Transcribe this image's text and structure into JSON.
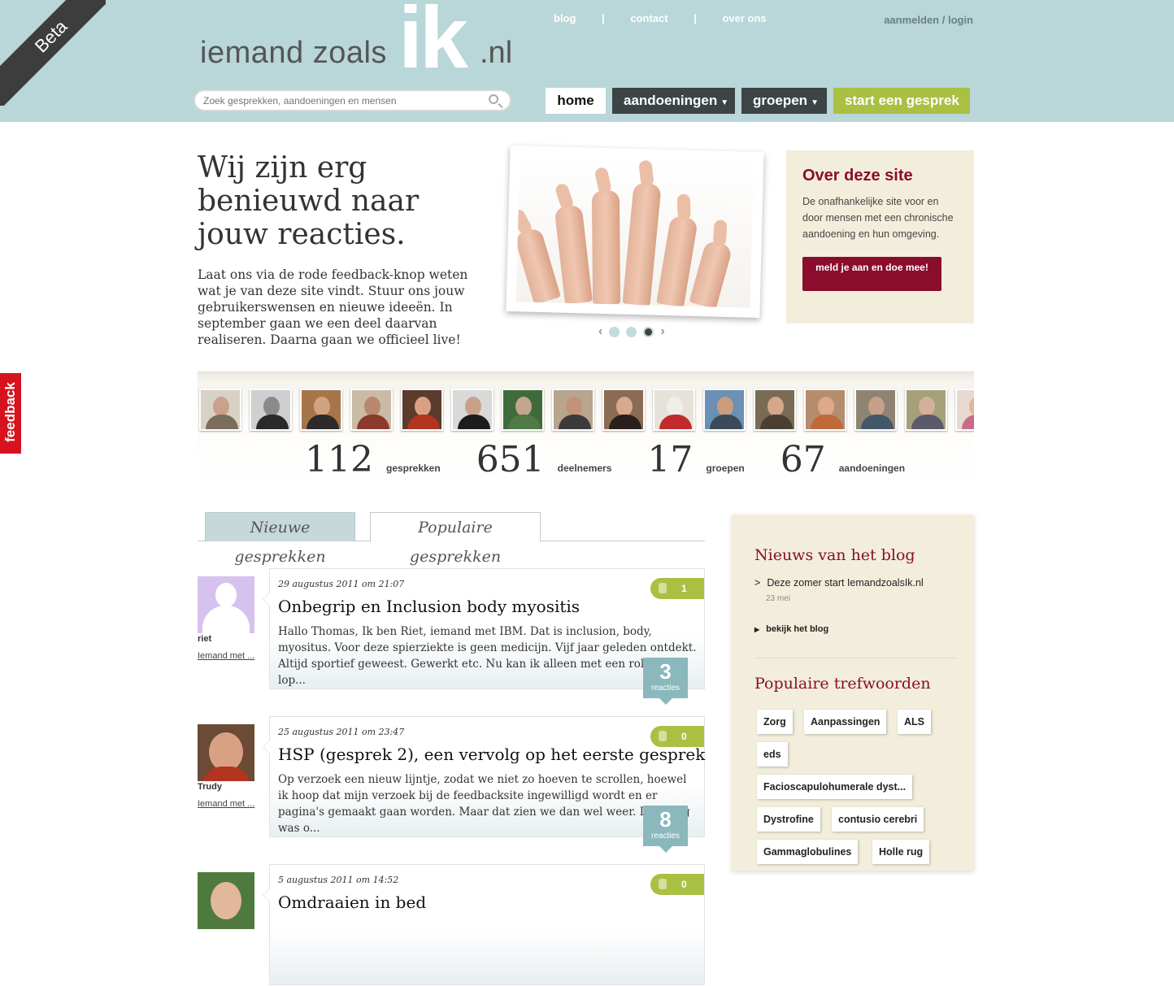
{
  "header": {
    "beta": "Beta",
    "logo_left": "iemand zoals",
    "logo_ik": "ik",
    "logo_right": ".nl",
    "top_links": [
      "blog",
      "contact",
      "over ons"
    ],
    "top_sep": "|",
    "login": "aanmelden / login",
    "search_placeholder": "Zoek gesprekken, aandoeningen en mensen",
    "nav": {
      "home": "home",
      "aandoeningen": "aandoeningen",
      "groepen": "groepen",
      "start": "start een gesprek"
    },
    "caret": "▼"
  },
  "hero": {
    "title": "Wij zijn erg benieuwd naar jouw reacties.",
    "text": "Laat ons via de rode feedback-knop weten wat je van deze site vindt. Stuur ons jouw gebruikerswensen en nieuwe ideeën. In september gaan we een deel daarvan realiseren. Daarna gaan we officieel live!",
    "prev": "‹",
    "next": "›"
  },
  "about": {
    "title": "Over deze site",
    "text": "De onafhankelijke site voor en door mensen met een chronische aandoening en hun omgeving.",
    "button": "meld je aan en doe mee!"
  },
  "feedback": "feedback",
  "stats": [
    {
      "num": "112",
      "label": "gesprekken"
    },
    {
      "num": "651",
      "label": "deelnemers"
    },
    {
      "num": "17",
      "label": "groepen"
    },
    {
      "num": "67",
      "label": "aandoeningen"
    }
  ],
  "tabs": {
    "new": "Nieuwe gesprekken",
    "popular": "Populaire gesprekken"
  },
  "conversations": [
    {
      "user": "riet",
      "user_link": "Iemand met ...",
      "date": "29 augustus 2011 om 21:07",
      "title": "Onbegrip en Inclusion body myositis",
      "excerpt": "Hallo Thomas, Ik ben Riet, iemand met IBM. Dat is inclusion, body, myositus. Voor deze spierziekte is geen medicijn. Vijf jaar geleden ontdekt. Altijd sportief geweest. Gewerkt etc. Nu kan ik alleen met een rollator lop...",
      "likes": "1",
      "reacties": "3",
      "reacties_label": "reacties"
    },
    {
      "user": "Trudy",
      "user_link": "Iemand met ...",
      "date": "25 augustus 2011 om 23:47",
      "title": "HSP (gesprek 2), een vervolg op het eerste gesprek",
      "excerpt": "Op verzoek een nieuw lijntje, zodat we niet zo hoeven te scrollen, hoewel ik hoop dat mijn verzoek bij de feedbacksite ingewilligd wordt en er pagina's gemaakt gaan worden. Maar dat zien we dan wel weer. De vraag was o...",
      "likes": "0",
      "reacties": "8",
      "reacties_label": "reacties"
    },
    {
      "date": "5 augustus 2011 om 14:52",
      "title": "Omdraaien in bed",
      "likes": "0"
    }
  ],
  "sidebar": {
    "blog_title": "Nieuws van het blog",
    "blog_item": "Deze zomer start IemandzoalsIk.nl",
    "blog_date": "23 mei",
    "blog_more": "bekijk het blog",
    "tags_title": "Populaire trefwoorden",
    "tags": [
      "Zorg",
      "Aanpassingen",
      "ALS",
      "eds",
      "Facioscapulohumerale dyst...",
      "Dystrofine",
      "contusio cerebri",
      "Gammaglobulines",
      "Holle rug"
    ]
  }
}
